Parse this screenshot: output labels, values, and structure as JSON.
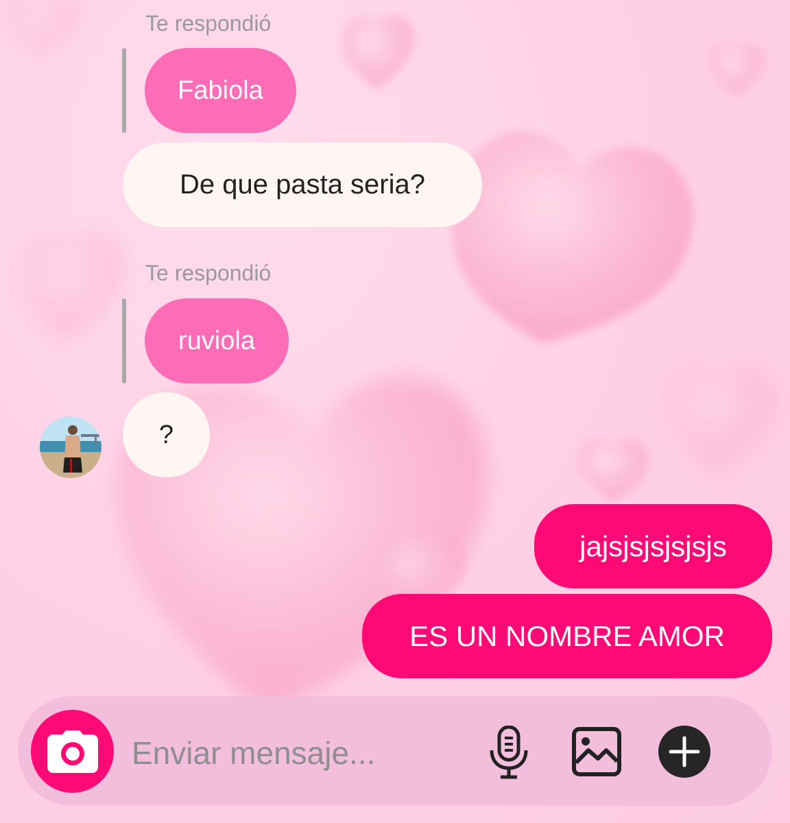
{
  "conversation": {
    "reply_label_1": "Te respondió",
    "quoted_1": "Fabiola",
    "message_1": "De que pasta seria?",
    "reply_label_2": "Te respondió",
    "quoted_2": "ruviola",
    "message_2": "?",
    "outgoing_1": "jajsjsjsjsjsjs",
    "outgoing_2": "ES UN NOMBRE AMOR"
  },
  "composer": {
    "placeholder": "Enviar mensaje...",
    "camera_icon": "camera-icon",
    "mic_icon": "microphone-icon",
    "gallery_icon": "image-icon",
    "plus_icon": "plus-circle-icon"
  },
  "colors": {
    "background": "#ffd2e6",
    "quoted_bubble": "#fd6cb7",
    "incoming_bubble": "#fff5f3",
    "outgoing_bubble": "#fe0a77",
    "composer_bar": "#f2bedb"
  }
}
